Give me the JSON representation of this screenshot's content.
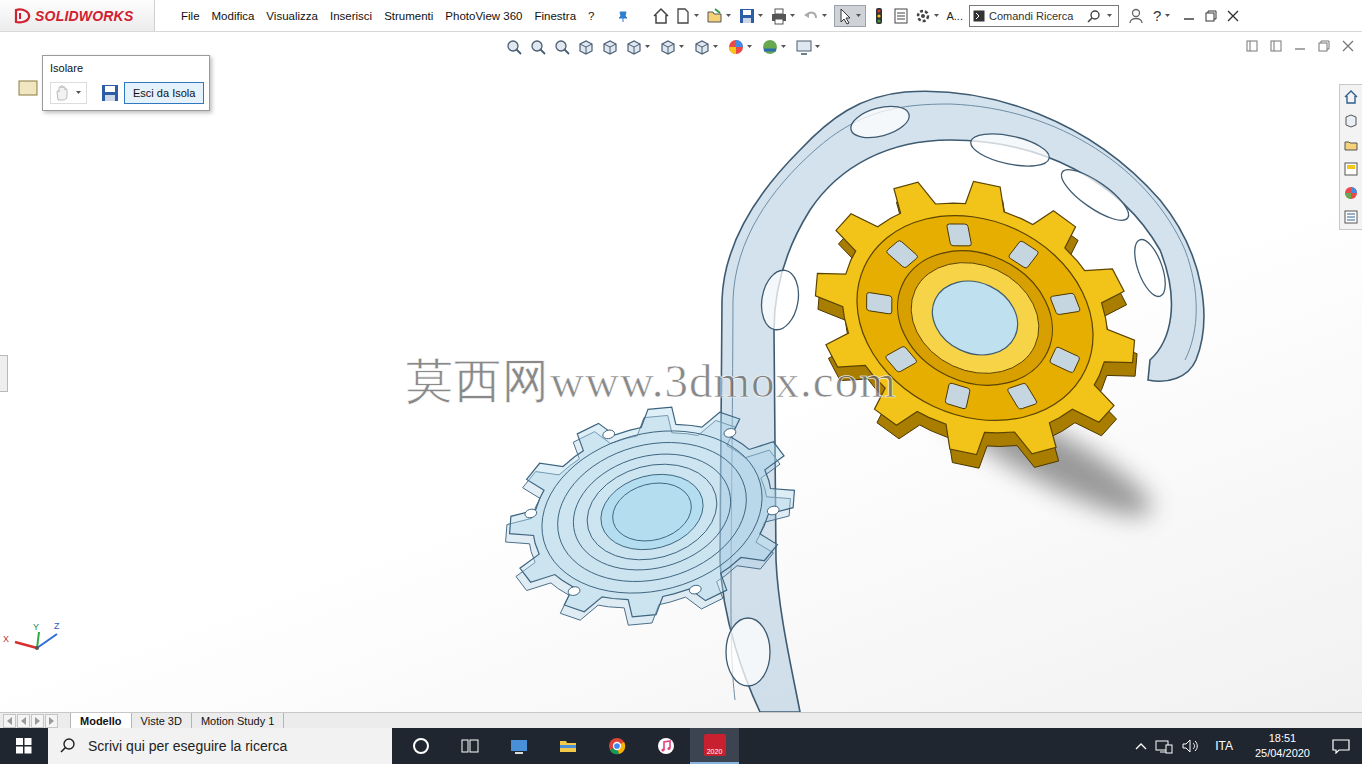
{
  "app": {
    "logo": "SOLIDWORKS"
  },
  "menu": [
    "File",
    "Modifica",
    "Visualizza",
    "Inserisci",
    "Strumenti",
    "PhotoView 360",
    "Finestra",
    "?"
  ],
  "toolbar": {
    "truncated_label": "A...",
    "search": "Comandi Ricerca",
    "help": "?"
  },
  "isolate_popup": {
    "title": "Isolare",
    "exit_button": "Esci da Isola"
  },
  "watermark": "莫西网www.3dmox.com",
  "triad": [
    "X",
    "Y",
    "Z"
  ],
  "model_tabs": [
    {
      "label": "Modello",
      "selected": true
    },
    {
      "label": "Viste 3D",
      "selected": false
    },
    {
      "label": "Motion Study 1",
      "selected": false
    }
  ],
  "taskbar": {
    "search_placeholder": "Scrivi qui per eseguire la ricerca",
    "app_badge": "2020",
    "language": "ITA",
    "time": "18:51",
    "date": "25/04/2020"
  }
}
